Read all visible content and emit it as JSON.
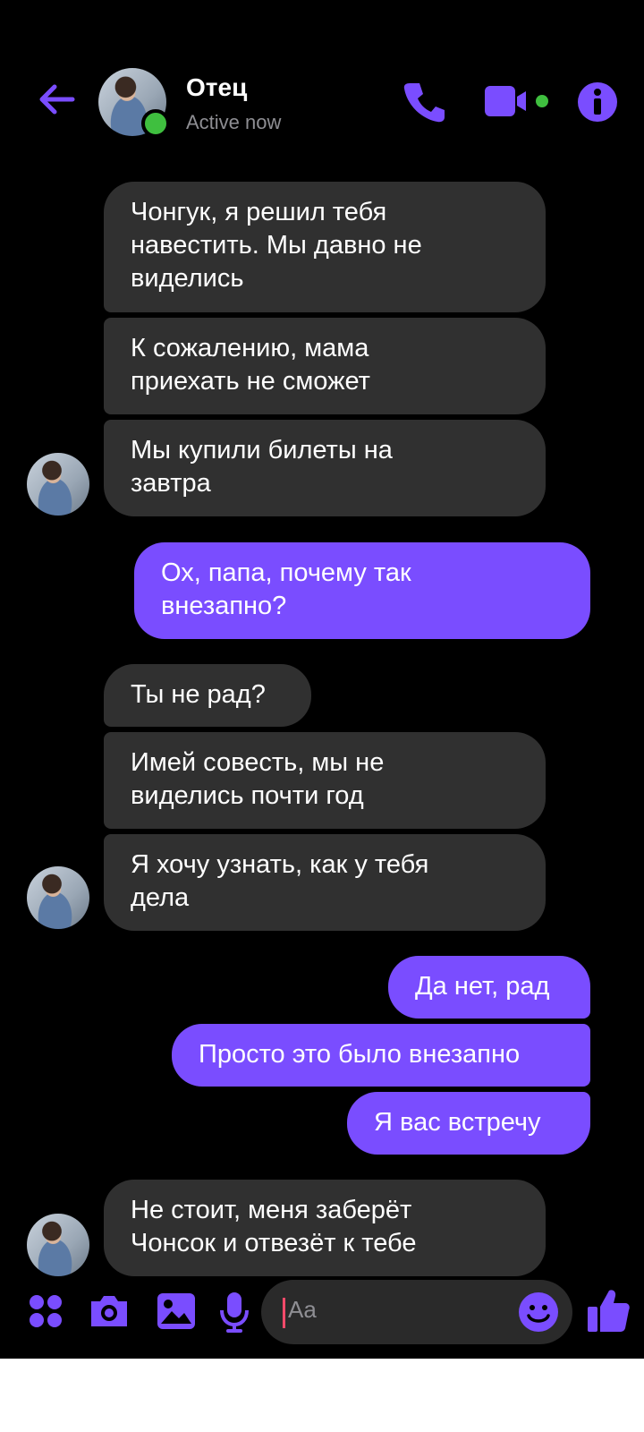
{
  "header": {
    "contact_name": "Отец",
    "status": "Active now"
  },
  "messages": [
    {
      "side": "in",
      "text": "Чонгук, я решил тебя\nнавестить. Мы давно не\nвиделись"
    },
    {
      "side": "in",
      "text": "К сожалению, мама\nприехать не сможет"
    },
    {
      "side": "in",
      "text": "Мы купили билеты на\nзавтра"
    },
    {
      "side": "out",
      "text": "Ох, папа, почему так\nвнезапно?"
    },
    {
      "side": "in",
      "text": "Ты не рад?"
    },
    {
      "side": "in",
      "text": "Имей совесть, мы не\nвиделись почти год"
    },
    {
      "side": "in",
      "text": "Я хочу узнать, как у тебя\nдела"
    },
    {
      "side": "out",
      "text": "Да нет, рад"
    },
    {
      "side": "out",
      "text": "Просто это было внезапно"
    },
    {
      "side": "out",
      "text": "Я вас встречу"
    },
    {
      "side": "in",
      "text": "Не стоит, меня заберёт\nЧонсок и отвезёт к тебе"
    }
  ],
  "composer": {
    "placeholder": "Aa"
  },
  "colors": {
    "accent": "#7a4dff",
    "incoming_bubble": "#303030",
    "online": "#3fbf3f"
  },
  "icons": [
    "back-arrow-icon",
    "phone-icon",
    "video-camera-icon",
    "info-icon",
    "apps-grid-icon",
    "camera-icon",
    "gallery-icon",
    "microphone-icon",
    "emoji-icon",
    "thumbs-up-icon"
  ]
}
